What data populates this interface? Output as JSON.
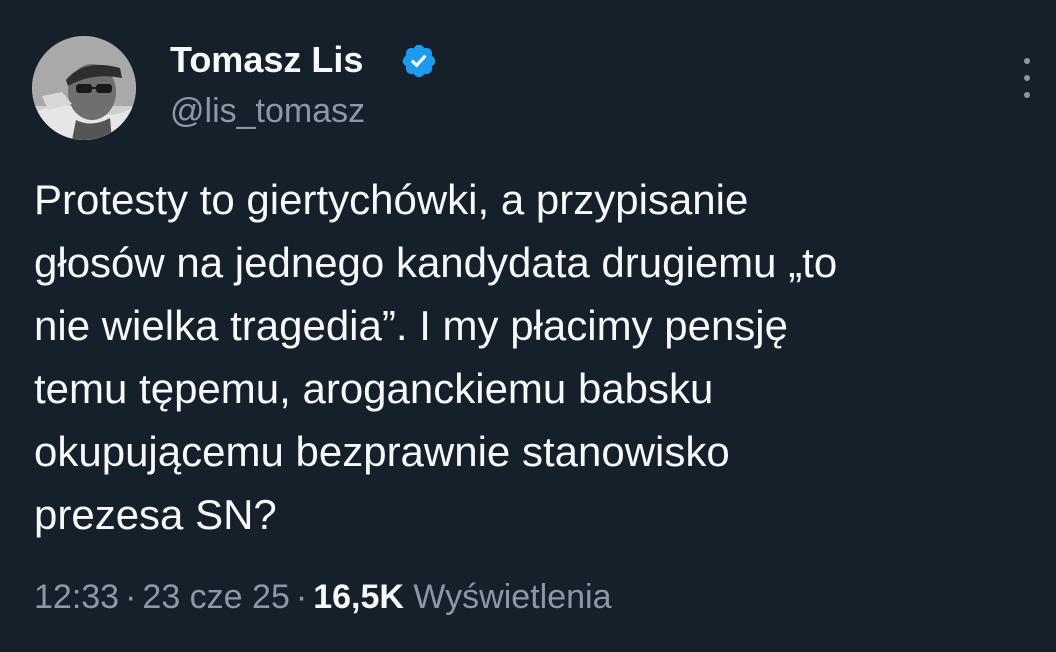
{
  "author": {
    "name": "Tomasz Lis",
    "handle": "@lis_tomasz",
    "verified": true,
    "avatar_icon": "profile-photo"
  },
  "tweet": {
    "lines": [
      "Protesty to giertychówki, a przypisanie",
      "głosów na jednego kandydata drugiemu „to",
      "nie wielka tragedia”. I my płacimy pensję",
      "temu tępemu, aroganckiemu babsku",
      "okupującemu bezprawnie stanowisko",
      "prezesa SN?"
    ]
  },
  "meta": {
    "time": "12:33",
    "date": "23 cze 25",
    "separator": "·",
    "views_count": "16,5K",
    "views_label": "Wyświetlenia"
  },
  "icons": {
    "more": "more-vertical-icon",
    "verified": "verified-badge-icon"
  },
  "colors": {
    "background": "#15202b",
    "text": "#f7f9f9",
    "secondary": "#8b98a5",
    "verified_blue": "#1d9bf0"
  }
}
